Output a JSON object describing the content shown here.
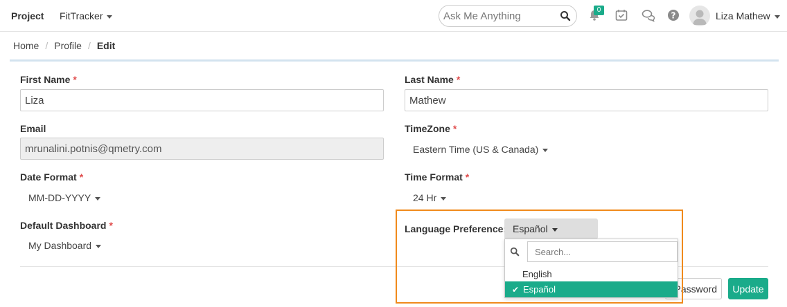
{
  "nav": {
    "project_label": "Project",
    "app_name": "FitTracker",
    "search_placeholder": "Ask Me Anything",
    "notification_count": "0",
    "user_name": "Liza Mathew"
  },
  "breadcrumb": {
    "home": "Home",
    "profile": "Profile",
    "current": "Edit"
  },
  "form": {
    "first_name": {
      "label": "First Name",
      "required": "*",
      "value": "Liza"
    },
    "last_name": {
      "label": "Last Name",
      "required": "*",
      "value": "Mathew"
    },
    "email": {
      "label": "Email",
      "value": "mrunalini.potnis@qmetry.com"
    },
    "timezone": {
      "label": "TimeZone",
      "required": "*",
      "value": "Eastern Time (US & Canada)"
    },
    "date_format": {
      "label": "Date Format",
      "required": "*",
      "value": "MM-DD-YYYY"
    },
    "time_format": {
      "label": "Time Format",
      "required": "*",
      "value": "24 Hr"
    },
    "default_dashboard": {
      "label": "Default Dashboard",
      "required": "*",
      "value": "My Dashboard"
    },
    "language": {
      "label": "Language Preference:",
      "value": "Español",
      "search_placeholder": "Search...",
      "options": [
        "English",
        "Español"
      ],
      "selected": "Español"
    }
  },
  "actions": {
    "password_label": "Password",
    "update_label": "Update"
  },
  "colors": {
    "accent": "#1aab8a",
    "highlight": "#f08a1c",
    "required": "#e04c4c"
  }
}
